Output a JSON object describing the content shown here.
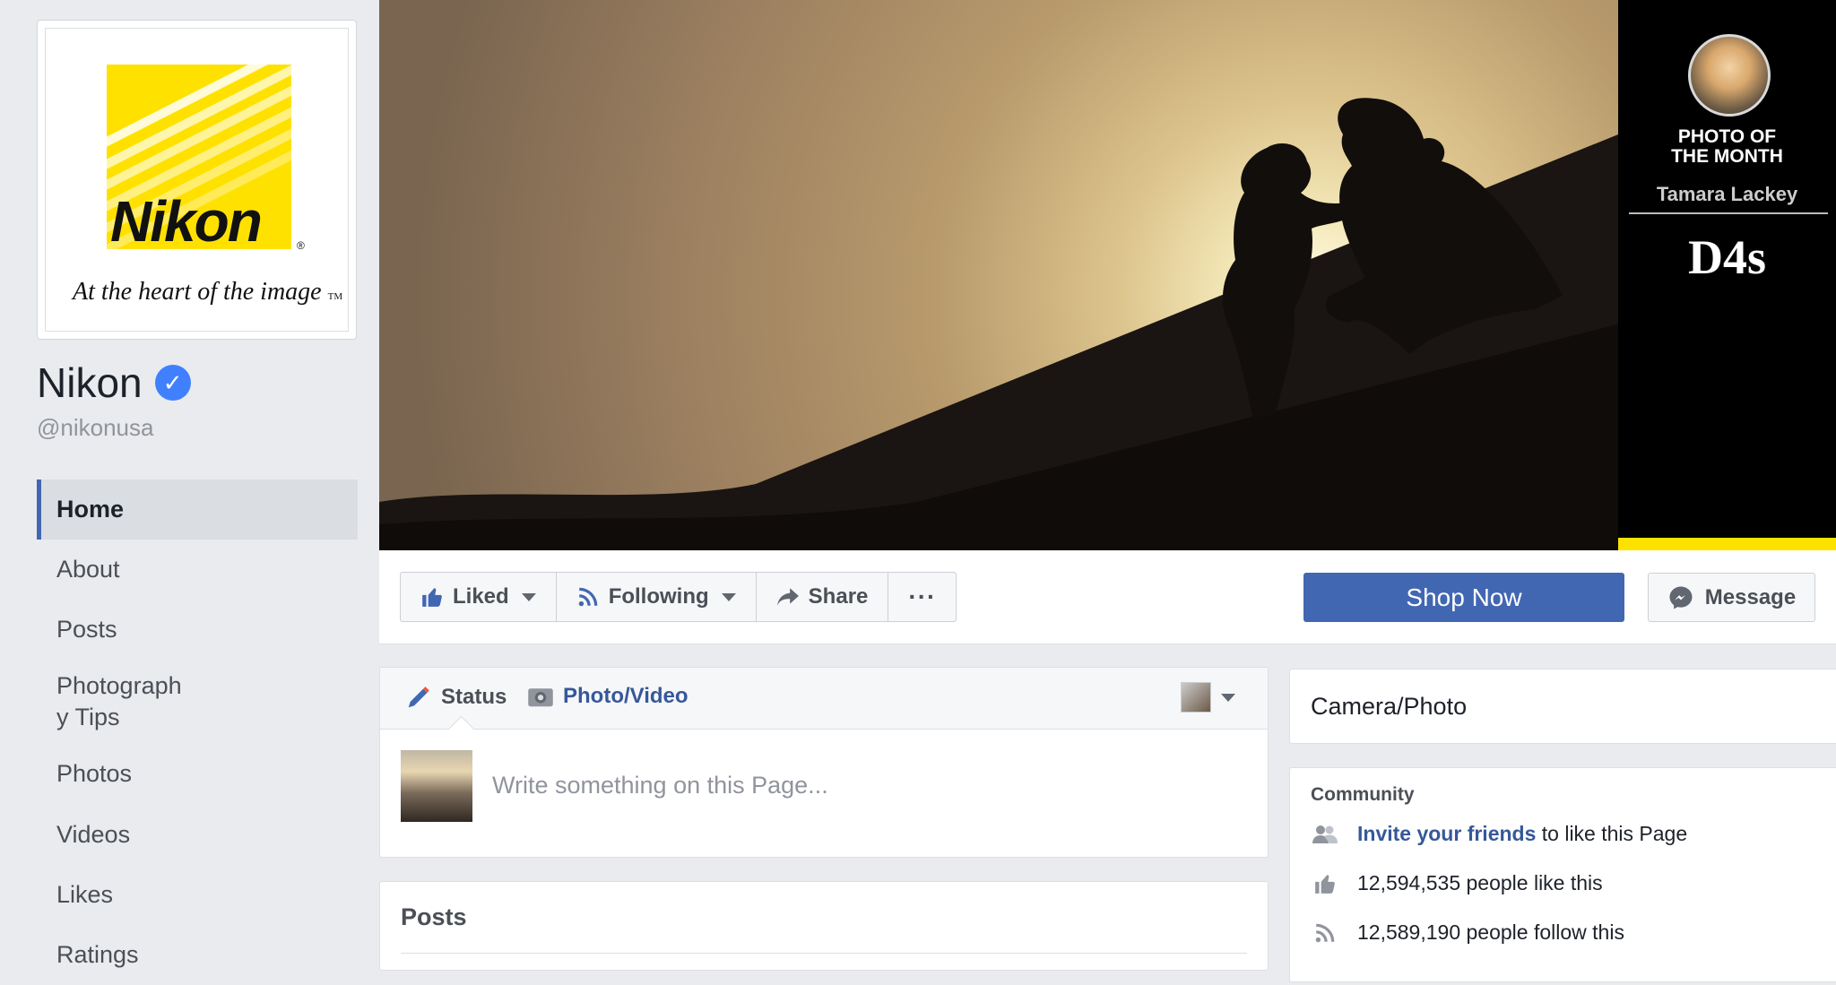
{
  "brand": {
    "logo_word": "Nikon",
    "logo_tagline": "At the heart of the image",
    "logo_trademark": "TM",
    "logo_registered": "®",
    "colors": {
      "yellow": "#ffe100",
      "facebook_blue": "#4267b2",
      "link_blue": "#365899"
    }
  },
  "page": {
    "name": "Nikon",
    "handle": "@nikonusa",
    "verified_icon": "verified-check-icon"
  },
  "sidebar": {
    "items": [
      {
        "label": "Home",
        "active": true
      },
      {
        "label": "About"
      },
      {
        "label": "Posts"
      },
      {
        "label": "Photograph\ny Tips"
      },
      {
        "label": "Photos"
      },
      {
        "label": "Videos"
      },
      {
        "label": "Likes"
      },
      {
        "label": "Ratings"
      }
    ]
  },
  "cover": {
    "promo": {
      "title_line1": "PHOTO OF",
      "title_line2": "THE MONTH",
      "photographer": "Tamara Lackey",
      "camera_model": "D4s"
    }
  },
  "actions": {
    "liked": "Liked",
    "following": "Following",
    "share": "Share",
    "more": "···",
    "shop_now": "Shop Now",
    "message": "Message"
  },
  "composer": {
    "tab_status": "Status",
    "tab_photo_video": "Photo/Video",
    "placeholder": "Write something on this Page..."
  },
  "posts": {
    "title": "Posts"
  },
  "right": {
    "category": "Camera/Photo",
    "community": {
      "title": "Community",
      "invite_link": "Invite your friends",
      "invite_rest": " to like this Page",
      "likes_text": "12,594,535 people like this",
      "follows_text": "12,589,190 people follow this"
    }
  }
}
